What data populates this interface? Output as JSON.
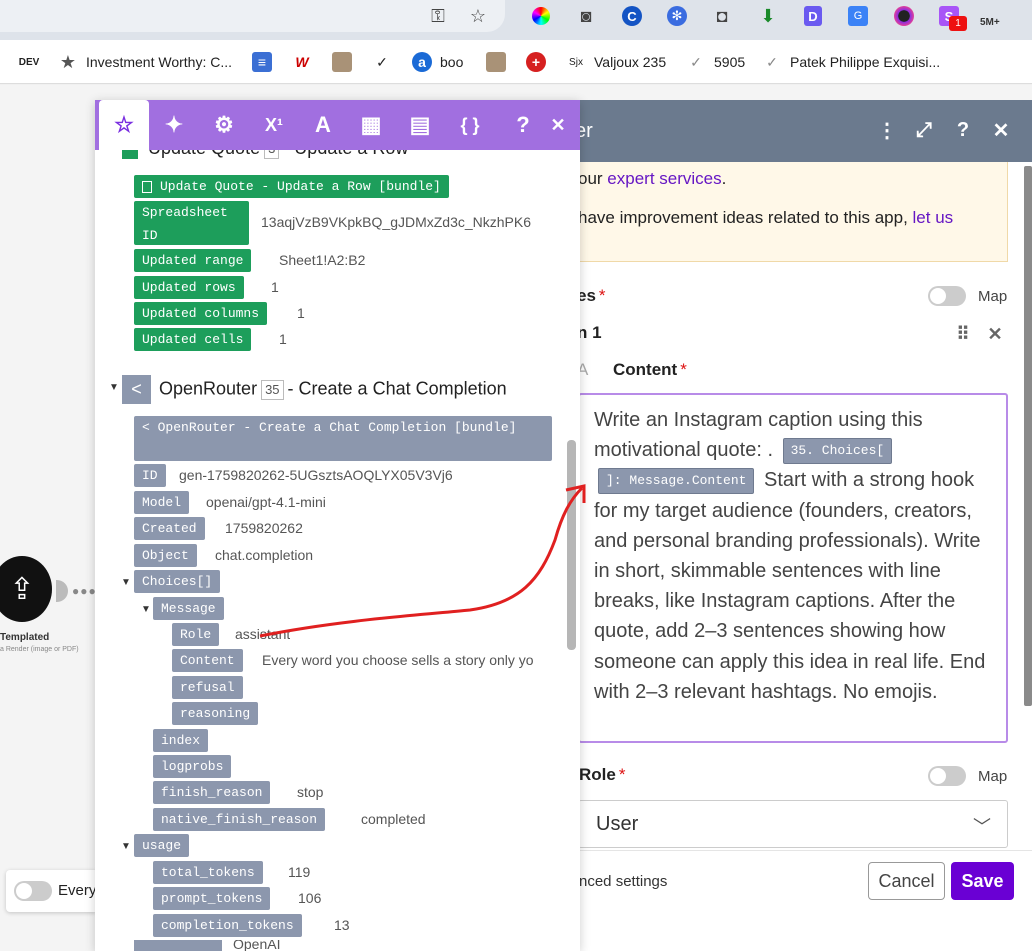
{
  "browser": {
    "extensions": [
      "key-icon",
      "star-icon",
      "color-wheel-icon",
      "camera-icon",
      "c-circle-icon",
      "snowflake-icon",
      "camera-outline-icon",
      "download-arrow-icon",
      "d-icon",
      "translate-icon",
      "record-icon",
      "s-icon"
    ],
    "ext_badge": "1",
    "ext_badge2": "5M+",
    "bookmarks": [
      {
        "label": "",
        "icon": "DEV"
      },
      {
        "label": "Investment Worthy: C...",
        "icon": "★"
      },
      {
        "label": "",
        "icon": "≡"
      },
      {
        "label": "",
        "icon": "W"
      },
      {
        "label": "",
        "icon": "img"
      },
      {
        "label": "",
        "icon": "✓"
      },
      {
        "label": "boo",
        "icon": "a"
      },
      {
        "label": "",
        "icon": "img"
      },
      {
        "label": "",
        "icon": "+"
      },
      {
        "label": "Valjoux 235",
        "icon": "Sjx"
      },
      {
        "label": "5905",
        "icon": "✓"
      },
      {
        "label": "Patek Philippe Exquisi...",
        "icon": "✓"
      }
    ]
  },
  "modal": {
    "title": "er",
    "info_line1_text": "our ",
    "info_line1_link": "expert services",
    "info_line1_end": ".",
    "info_line2_text": "have improvement ideas related to this app, ",
    "info_line2_link": "let us",
    "messages_label": "es",
    "map_label": "Map",
    "item_label": "n 1",
    "content_label": "Content",
    "content_prefix": "A",
    "content_text_1": "Write an Instagram caption using this motivational quote: . ",
    "content_pill_1": "35. Choices[",
    "content_pill_2": "]: Message.Content",
    "content_text_2": " Start with a strong hook for my target audience (founders, creators, and personal branding professionals). Write in short, skimmable sentences with line breaks, like Instagram captions. After the quote, add 2–3 sentences showing how someone can apply this idea in real life. End with 2–3 relevant hashtags. No emojis.",
    "role_label": "Role",
    "role_value": "User",
    "advanced_label": "nced settings",
    "cancel_label": "Cancel",
    "save_label": "Save"
  },
  "picker": {
    "tabs": [
      "star-icon",
      "sparkles-icon",
      "gear-icon",
      "superscript-icon",
      "text-icon",
      "calendar-icon",
      "table-icon",
      "braces-icon",
      "help-icon",
      "close-icon"
    ],
    "tab_glyphs": [
      "☆",
      "✦",
      "⚙",
      "X¹",
      "A",
      "▦",
      "▤",
      "{ }",
      "?",
      "✕"
    ],
    "top_module_head": "Update Quote",
    "top_module_num": "3",
    "top_module_tail": "- Update a Row",
    "sheet_bundle": "Update Quote - Update a Row [bundle]",
    "sheet_rows": [
      {
        "key": "Spreadsheet ID",
        "value": "13aqjVzB9VKpkBQ_gJDMxZd3c_NkzhPK6"
      },
      {
        "key": "Updated range",
        "value": "Sheet1!A2:B2"
      },
      {
        "key": "Updated rows",
        "value": "1"
      },
      {
        "key": "Updated columns",
        "value": "1"
      },
      {
        "key": "Updated cells",
        "value": "1"
      }
    ],
    "or_module_name": "OpenRouter",
    "or_module_num": "35",
    "or_module_tail": "- Create a Chat Completion",
    "or_bundle": "OpenRouter - Create a Chat Completion [bundle]",
    "or_rows": [
      {
        "key": "ID",
        "value": "gen-1759820262-5UGsztsAOQLYX05V3Vj6"
      },
      {
        "key": "Model",
        "value": "openai/gpt-4.1-mini"
      },
      {
        "key": "Created",
        "value": "1759820262"
      },
      {
        "key": "Object",
        "value": "chat.completion"
      }
    ],
    "choices_label": "Choices[]",
    "message_label": "Message",
    "message_rows": [
      {
        "key": "Role",
        "value": "assistant"
      },
      {
        "key": "Content",
        "value": "Every word you choose sells a story only yo"
      },
      {
        "key": "refusal",
        "value": ""
      },
      {
        "key": "reasoning",
        "value": ""
      }
    ],
    "choice_rows": [
      {
        "key": "index",
        "value": ""
      },
      {
        "key": "logprobs",
        "value": ""
      },
      {
        "key": "finish_reason",
        "value": "stop"
      },
      {
        "key": "native_finish_reason",
        "value": "completed"
      }
    ],
    "usage_label": "usage",
    "usage_rows": [
      {
        "key": "total_tokens",
        "value": "119"
      },
      {
        "key": "prompt_tokens",
        "value": "106"
      },
      {
        "key": "completion_tokens",
        "value": "13"
      }
    ],
    "last_partial_value": "OpenAI"
  },
  "canvas": {
    "node_label": "Templated",
    "node_sub": "a Render (image or PDF)",
    "every_label": "Every"
  }
}
